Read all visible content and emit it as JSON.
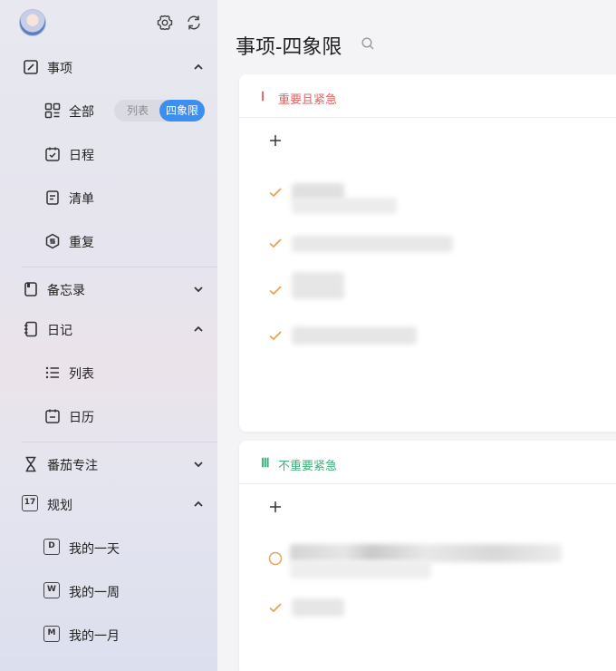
{
  "sidebar": {
    "sections": {
      "tasks": "事项",
      "memo": "备忘录",
      "diary": "日记",
      "focus": "番茄专注",
      "plan": "规划"
    },
    "tasks_items": {
      "all": "全部",
      "schedule": "日程",
      "checklist": "清单",
      "repeat": "重复"
    },
    "view_toggle": {
      "list": "列表",
      "quadrant": "四象限"
    },
    "diary_items": {
      "list": "列表",
      "calendar": "日历"
    },
    "plan_items": {
      "day": "我的一天",
      "week": "我的一周",
      "month": "我的一月"
    },
    "calendar_badge": "17",
    "day_badge": "D",
    "week_badge": "W",
    "month_badge": "M"
  },
  "main": {
    "title": "事项-四象限",
    "quadrants": [
      {
        "roman": "Ⅰ",
        "title": "重要且紧急",
        "color": "#e06666"
      },
      {
        "roman": "Ⅲ",
        "title": "不重要紧急",
        "color": "#3fb07a"
      }
    ]
  },
  "colors": {
    "accent": "#3b8ff0",
    "check": "#e6a25a"
  },
  "icons": [
    "settings-icon",
    "sync-icon",
    "search-icon",
    "plus-icon",
    "check-icon",
    "circle-icon"
  ]
}
